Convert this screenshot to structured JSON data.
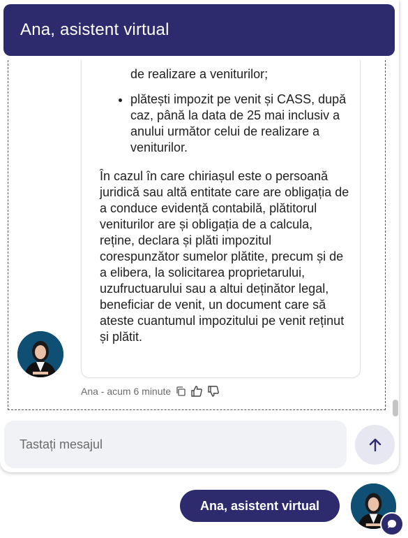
{
  "header": {
    "title": "Ana, asistent virtual"
  },
  "message": {
    "continuation": "de realizare a veniturilor;",
    "list_items": [
      "plătești impozit pe venit și CASS, după caz, până la data de 25 mai inclusiv a anului următor celui de realizare a veniturilor."
    ],
    "paragraph": "În cazul în care chiriașul este o persoană juridică sau altă entitate care are obligația de a conduce evidență contabilă, plătitorul veniturilor are și obligația de a calcula, reține, declara și plăti impozitul corespunzător sumelor plătite, precum și de a elibera, la solicitarea proprietarului, uzufructuarului sau a altui deținător legal, beneficiar de venit, un document care să ateste cuantumul impozitului pe venit reținut și plătit.",
    "meta": "Ana - acum 6 minute"
  },
  "icons": {
    "copy": "copy-icon",
    "like": "thumbs-up-icon",
    "dislike": "thumbs-down-icon",
    "send": "arrow-up-icon",
    "badge": "chat-bubble-icon"
  },
  "input": {
    "placeholder": "Tastați mesajul"
  },
  "launcher": {
    "label": "Ana, asistent virtual"
  },
  "colors": {
    "brand": "#2d2a6e",
    "input_bg": "#f1f2f6",
    "send_bg": "#e6e7f1"
  }
}
